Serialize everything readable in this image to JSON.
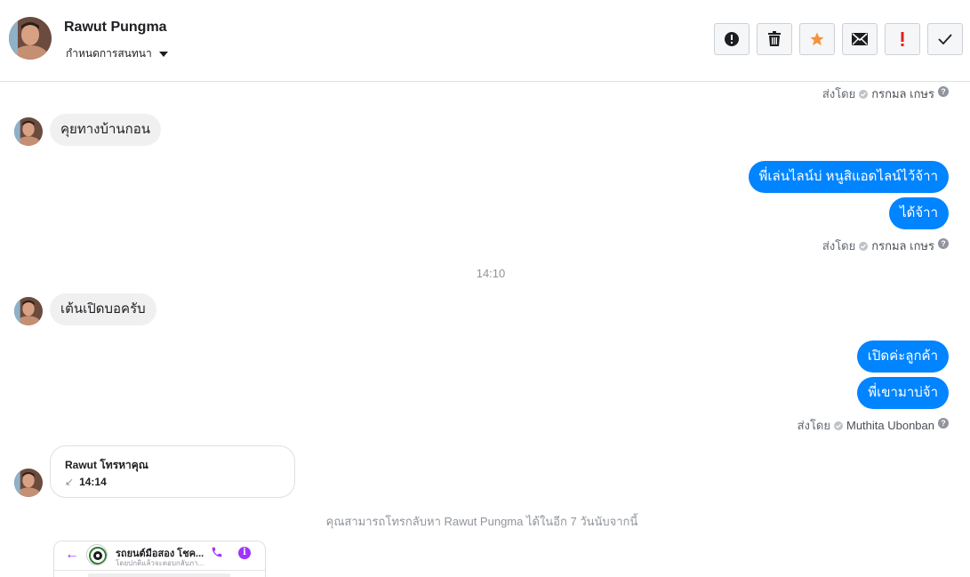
{
  "header": {
    "contact_name": "Rawut Pungma",
    "assign_label": "กำหนดการสนทนา",
    "actions": [
      {
        "icon": "alert-circle-icon",
        "name": "spam-button"
      },
      {
        "icon": "trash-icon",
        "name": "delete-button"
      },
      {
        "icon": "star-icon",
        "name": "star-button",
        "color": "#f7923b"
      },
      {
        "icon": "envelope-icon",
        "name": "mark-unread-button"
      },
      {
        "icon": "exclamation-icon",
        "name": "follow-up-button",
        "color": "#e02020"
      },
      {
        "icon": "check-icon",
        "name": "done-button"
      }
    ]
  },
  "messages": {
    "sent_by_label": "ส่งโดย",
    "sent_by_1": "กรกมล เกษร",
    "in_1": "คุยทางบ้านกอน",
    "out_1": "พี่เล่นไลน์บ่ หนูสิแอดไลน์ไว้จ้าา",
    "out_2": "ได้จ้าา",
    "sent_by_2": "กรกมล เกษร",
    "time_1": "14:10",
    "in_2": "เต้นเปิดบอครับ",
    "out_3": "เปิดค่ะลูกค้า",
    "out_4": "พี่เขามาบ่จ้า",
    "sent_by_3": "Muthita Ubonban"
  },
  "call": {
    "title": "Rawut โทรหาคุณ",
    "time": "14:14",
    "callback_note": "คุณสามารถโทรกลับหา Rawut Pungma ได้ในอีก 7 วันนับจากนี้"
  },
  "preview": {
    "title": "รถยนต์มือสอง โชค...",
    "subtitle": "โดยปกติแล้วจะตอบกลับภา..."
  },
  "colors": {
    "accent": "#0084ff",
    "incoming_bubble": "#f1f0f0",
    "muted_text": "#90949c"
  }
}
